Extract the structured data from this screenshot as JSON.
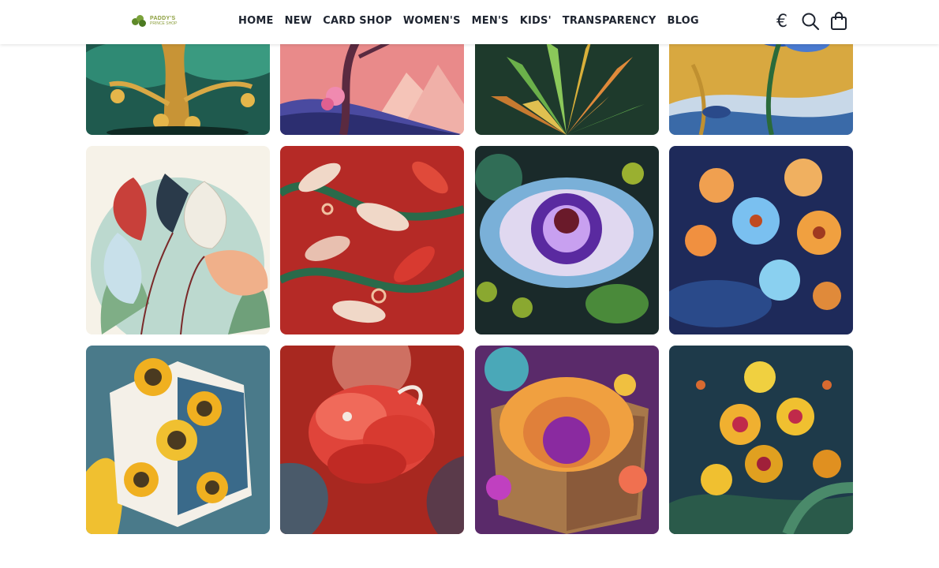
{
  "brand": {
    "line1": "PADDY'S",
    "line2": "PRINCE SHOP"
  },
  "nav": [
    {
      "label": "HOME"
    },
    {
      "label": "NEW"
    },
    {
      "label": "CARD SHOP"
    },
    {
      "label": "WOMEN'S"
    },
    {
      "label": "MEN'S"
    },
    {
      "label": "KIDS'"
    },
    {
      "label": "TRANSPARENCY"
    },
    {
      "label": "BLOG"
    }
  ],
  "header_icons": {
    "currency_symbol": "€",
    "search": "search-icon",
    "cart": "shopping-bag-icon"
  },
  "colors": {
    "text": "#1e2430",
    "logo_green": "#8a9d3a",
    "background": "#ffffff"
  },
  "gallery": [
    {
      "name": "money-tree-art"
    },
    {
      "name": "pink-tree-mountain-art"
    },
    {
      "name": "green-leaf-plant-art"
    },
    {
      "name": "blue-iris-art"
    },
    {
      "name": "anthurium-leaves-art"
    },
    {
      "name": "red-leaf-pattern-art"
    },
    {
      "name": "passion-flower-art"
    },
    {
      "name": "orange-orchid-art"
    },
    {
      "name": "sunflower-box-art"
    },
    {
      "name": "red-hibiscus-art"
    },
    {
      "name": "flower-box-art"
    },
    {
      "name": "yellow-orchid-art"
    }
  ]
}
